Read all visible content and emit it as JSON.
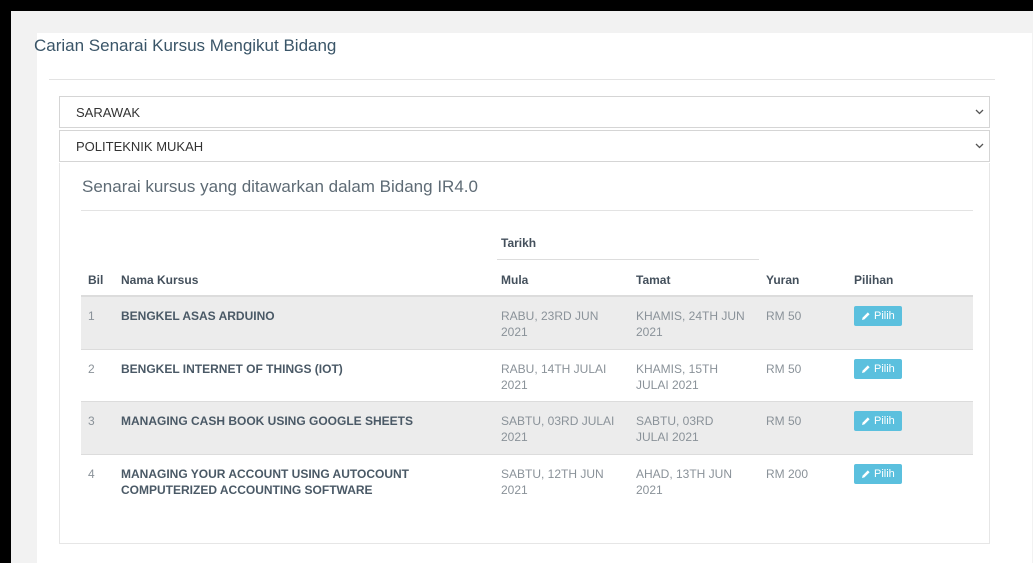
{
  "filter": {
    "title": "Carian Senarai Kursus Mengikut Bidang",
    "state_selected": "SARAWAK",
    "institution_selected": "POLITEKNIK MUKAH"
  },
  "course_list": {
    "title": "Senarai kursus yang ditawarkan dalam Bidang IR4.0",
    "columns": {
      "bil": "Bil",
      "nama_kursus": "Nama Kursus",
      "tarikh": "Tarikh",
      "mula": "Mula",
      "tamat": "Tamat",
      "yuran": "Yuran",
      "pilihan": "Pilihan"
    },
    "select_label": "Pilih",
    "rows": [
      {
        "bil": "1",
        "nama": "BENGKEL ASAS ARDUINO",
        "mula": "RABU, 23RD JUN 2021",
        "tamat": "KHAMIS, 24TH JUN 2021",
        "yuran": "RM 50"
      },
      {
        "bil": "2",
        "nama": "BENGKEL INTERNET OF THINGS (IOT)",
        "mula": "RABU, 14TH JULAI 2021",
        "tamat": "KHAMIS, 15TH JULAI 2021",
        "yuran": "RM 50"
      },
      {
        "bil": "3",
        "nama": "MANAGING CASH BOOK USING GOOGLE SHEETS",
        "mula": "SABTU, 03RD JULAI 2021",
        "tamat": "SABTU, 03RD JULAI 2021",
        "yuran": "RM 50"
      },
      {
        "bil": "4",
        "nama": "MANAGING YOUR ACCOUNT USING AUTOCOUNT COMPUTERIZED ACCOUNTING SOFTWARE",
        "mula": "SABTU, 12TH JUN 2021",
        "tamat": "AHAD, 13TH JUN 2021",
        "yuran": "RM 200"
      }
    ]
  },
  "colors": {
    "button": "#5bc0de",
    "row_shade": "#ececec"
  },
  "icons": {
    "dropdown": "chevron-down-icon",
    "button": "pencil-icon"
  }
}
